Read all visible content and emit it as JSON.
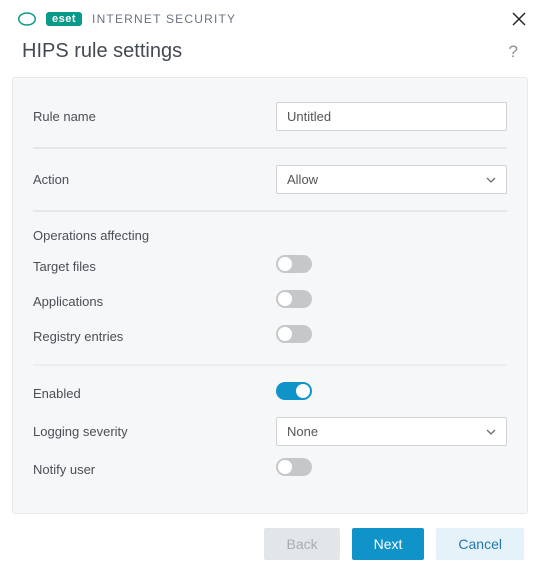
{
  "brand": {
    "logo_text": "eset",
    "product": "INTERNET SECURITY"
  },
  "header": {
    "title": "HIPS rule settings"
  },
  "form": {
    "rule_name_label": "Rule name",
    "rule_name_value": "Untitled",
    "action_label": "Action",
    "action_value": "Allow",
    "operations_heading": "Operations affecting",
    "target_files_label": "Target files",
    "applications_label": "Applications",
    "registry_entries_label": "Registry entries",
    "enabled_label": "Enabled",
    "logging_severity_label": "Logging severity",
    "logging_severity_value": "None",
    "notify_user_label": "Notify user",
    "toggles": {
      "target_files": false,
      "applications": false,
      "registry_entries": false,
      "enabled": true,
      "notify_user": false
    }
  },
  "footer": {
    "back": "Back",
    "next": "Next",
    "cancel": "Cancel"
  }
}
